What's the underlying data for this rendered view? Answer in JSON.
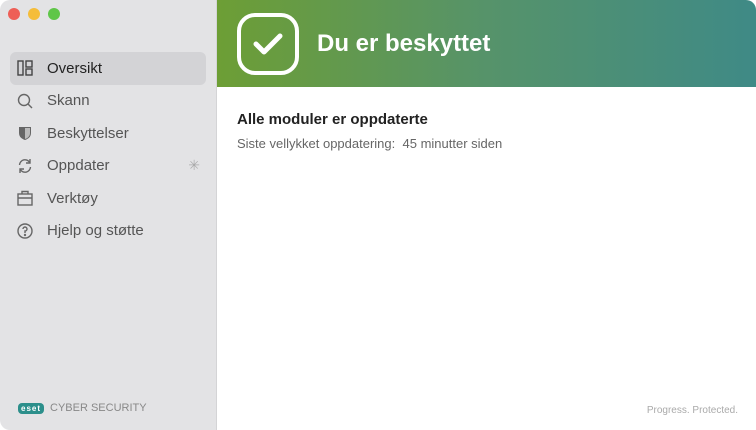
{
  "sidebar": {
    "items": [
      {
        "label": "Oversikt",
        "icon": "dashboard-icon"
      },
      {
        "label": "Skann",
        "icon": "search-icon"
      },
      {
        "label": "Beskyttelser",
        "icon": "shield-icon"
      },
      {
        "label": "Oppdater",
        "icon": "refresh-icon"
      },
      {
        "label": "Verktøy",
        "icon": "toolbox-icon"
      },
      {
        "label": "Hjelp og støtte",
        "icon": "help-icon"
      }
    ],
    "brand_logo": "ESET",
    "brand_text": "CYBER SECURITY"
  },
  "header": {
    "status": "Du er beskyttet"
  },
  "main": {
    "title": "Alle moduler er oppdaterte",
    "last_update_label": "Siste vellykket oppdatering:",
    "last_update_value": "45 minutter siden"
  },
  "footer": {
    "tagline": "Progress. Protected."
  },
  "colors": {
    "accent_start": "#6d9e35",
    "accent_end": "#3f8a86"
  }
}
